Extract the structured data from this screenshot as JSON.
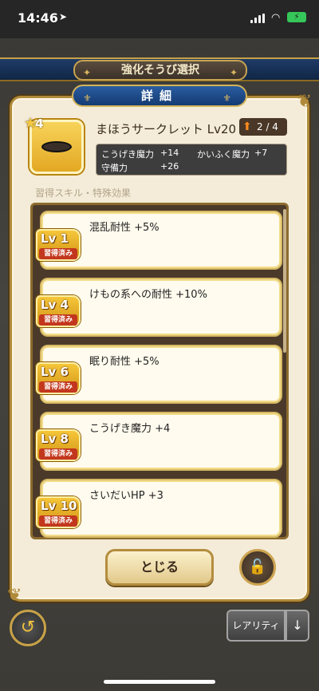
{
  "status_bar": {
    "time": "14:46",
    "location_icon": "location-arrow-icon",
    "battery_icon": "battery-charging-icon"
  },
  "screen": {
    "title": "強化そうび選択"
  },
  "dialog": {
    "title": "詳細",
    "item": {
      "star_rank": "4",
      "icon": "ring-icon",
      "name": "まほうサークレット Lv20",
      "level_progress": "2 / 4",
      "stats": [
        {
          "label": "こうげき魔力",
          "value": "+14"
        },
        {
          "label": "かいふく魔力",
          "value": "+7"
        },
        {
          "label": "守備力",
          "value": "+26"
        }
      ]
    },
    "section_label": "習得スキル・特殊効果",
    "skills": [
      {
        "level": "Lv 1",
        "status": "習得済み",
        "text": "混乱耐性 +5%"
      },
      {
        "level": "Lv 4",
        "status": "習得済み",
        "text": "けもの系への耐性 +10%"
      },
      {
        "level": "Lv 6",
        "status": "習得済み",
        "text": "眠り耐性 +5%"
      },
      {
        "level": "Lv 8",
        "status": "習得済み",
        "text": "こうげき魔力 +4"
      },
      {
        "level": "Lv 10",
        "status": "習得済み",
        "text": "さいだいHP +3"
      }
    ],
    "close_label": "とじる"
  },
  "footer": {
    "rarity_label": "レアリティ"
  },
  "colors": {
    "dialog_bg": "#f4ecd8",
    "gold_border": "#b08a3a",
    "title_blue": "#1f4b8a",
    "acquired_red": "#c2371d"
  }
}
